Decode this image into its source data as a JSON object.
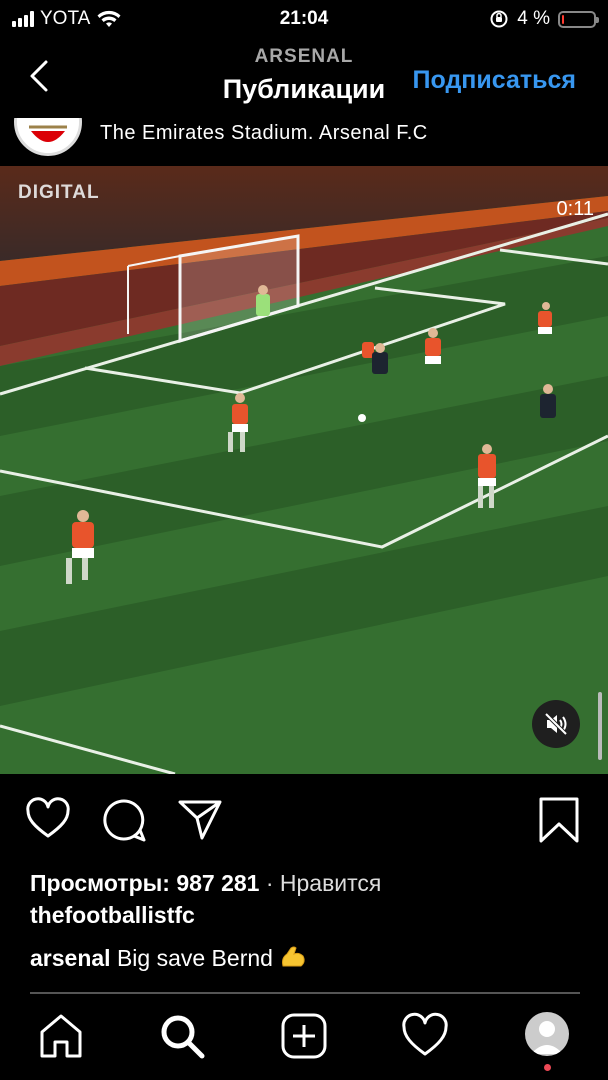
{
  "status_bar": {
    "carrier": "YOTA",
    "time": "21:04",
    "battery_text": "4 %",
    "battery_level": 0.04
  },
  "header": {
    "account": "ARSENAL",
    "title": "Публикации",
    "follow_label": "Подписаться"
  },
  "post": {
    "location": "The Emirates Stadium. Arsenal F.C",
    "video": {
      "watermark": "DIGITAL",
      "timer": "0:11"
    },
    "views_label": "Просмотры:",
    "views_count": "987 281",
    "likes_label": "· Нравится",
    "liked_by": "thefootballistfc",
    "caption_user": "arsenal",
    "caption_text": "Big save Bernd"
  },
  "icons": {
    "back": "chevron-left-icon",
    "like": "heart-icon",
    "comment": "comment-icon",
    "share": "paper-plane-icon",
    "save": "bookmark-icon",
    "mute": "speaker-muted-icon",
    "tabs": [
      "home-icon",
      "search-icon",
      "add-post-icon",
      "activity-heart-icon",
      "profile-avatar"
    ]
  },
  "colors": {
    "accent": "#3897f0",
    "background": "#000000",
    "notification": "#ed4956"
  }
}
